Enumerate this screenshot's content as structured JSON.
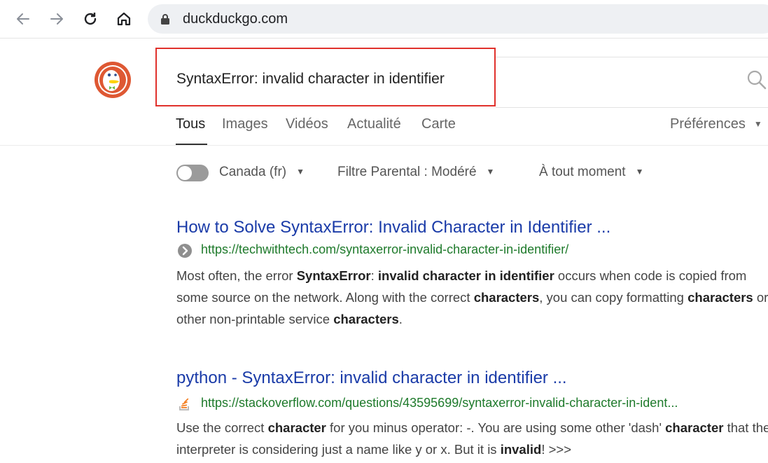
{
  "browser": {
    "url": "duckduckgo.com"
  },
  "search": {
    "query": "SyntaxError: invalid character in identifier"
  },
  "tabs": [
    "Tous",
    "Images",
    "Vidéos",
    "Actualité",
    "Carte"
  ],
  "preferences_label": "Préférences",
  "filters": {
    "region": "Canada (fr)",
    "safe_search": "Filtre Parental : Modéré",
    "time": "À tout moment"
  },
  "results": [
    {
      "title": "How to Solve SyntaxError: Invalid Character in Identifier ...",
      "url": "https://techwithtech.com/syntaxerror-invalid-character-in-identifier/",
      "snippet_parts": [
        [
          "Most often, the error ",
          false
        ],
        [
          "SyntaxError",
          true
        ],
        [
          ": ",
          false
        ],
        [
          "invalid character in identifier",
          true
        ],
        [
          " occurs when code is copied from some source on the network. Along with the correct ",
          false
        ],
        [
          "characters",
          true
        ],
        [
          ", you can copy formatting ",
          false
        ],
        [
          "characters",
          true
        ],
        [
          " or other non-printable service ",
          false
        ],
        [
          "characters",
          true
        ],
        [
          ".",
          false
        ]
      ]
    },
    {
      "title": "python - SyntaxError: invalid character in identifier ...",
      "url": "https://stackoverflow.com/questions/43595699/syntaxerror-invalid-character-in-ident...",
      "snippet_parts": [
        [
          "Use the correct ",
          false
        ],
        [
          "character",
          true
        ],
        [
          " for you minus operator: -. You are using some other 'dash' ",
          false
        ],
        [
          "character",
          true
        ],
        [
          " that the interpreter is considering just a name like y or x. But it is ",
          false
        ],
        [
          "invalid",
          true
        ],
        [
          "! >>>",
          false
        ]
      ]
    }
  ],
  "colors": {
    "link": "#1a3ba8",
    "url": "#1e7a2b",
    "highlight_box": "#e0312c"
  }
}
